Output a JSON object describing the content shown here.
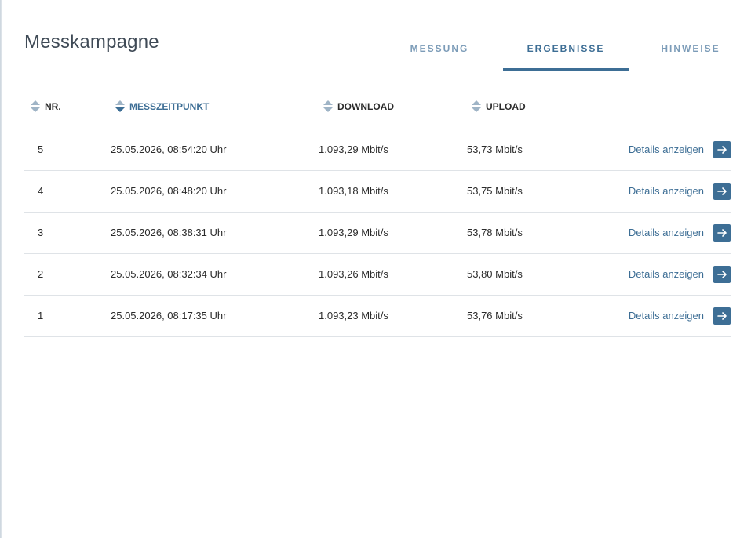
{
  "page": {
    "title": "Messkampagne"
  },
  "tabs": [
    {
      "label": "MESSUNG",
      "active": false
    },
    {
      "label": "ERGEBNISSE",
      "active": true
    },
    {
      "label": "HINWEISE",
      "active": false
    }
  ],
  "table": {
    "columns": [
      {
        "label": "NR.",
        "sorted": false
      },
      {
        "label": "MESSZEITPUNKT",
        "sorted": true,
        "direction": "desc"
      },
      {
        "label": "DOWNLOAD",
        "sorted": false
      },
      {
        "label": "UPLOAD",
        "sorted": false
      }
    ],
    "details_label": "Details anzeigen",
    "rows": [
      {
        "nr": "5",
        "time": "25.05.2026, 08:54:20 Uhr",
        "download": "1.093,29 Mbit/s",
        "upload": "53,73 Mbit/s"
      },
      {
        "nr": "4",
        "time": "25.05.2026, 08:48:20 Uhr",
        "download": "1.093,18 Mbit/s",
        "upload": "53,75 Mbit/s"
      },
      {
        "nr": "3",
        "time": "25.05.2026, 08:38:31 Uhr",
        "download": "1.093,29 Mbit/s",
        "upload": "53,78 Mbit/s"
      },
      {
        "nr": "2",
        "time": "25.05.2026, 08:32:34 Uhr",
        "download": "1.093,26 Mbit/s",
        "upload": "53,80 Mbit/s"
      },
      {
        "nr": "1",
        "time": "25.05.2026, 08:17:35 Uhr",
        "download": "1.093,23 Mbit/s",
        "upload": "53,76 Mbit/s"
      }
    ]
  },
  "colors": {
    "accent": "#3d6e95",
    "tab_inactive": "#7c9cb8",
    "divider": "#dfe3e7"
  }
}
